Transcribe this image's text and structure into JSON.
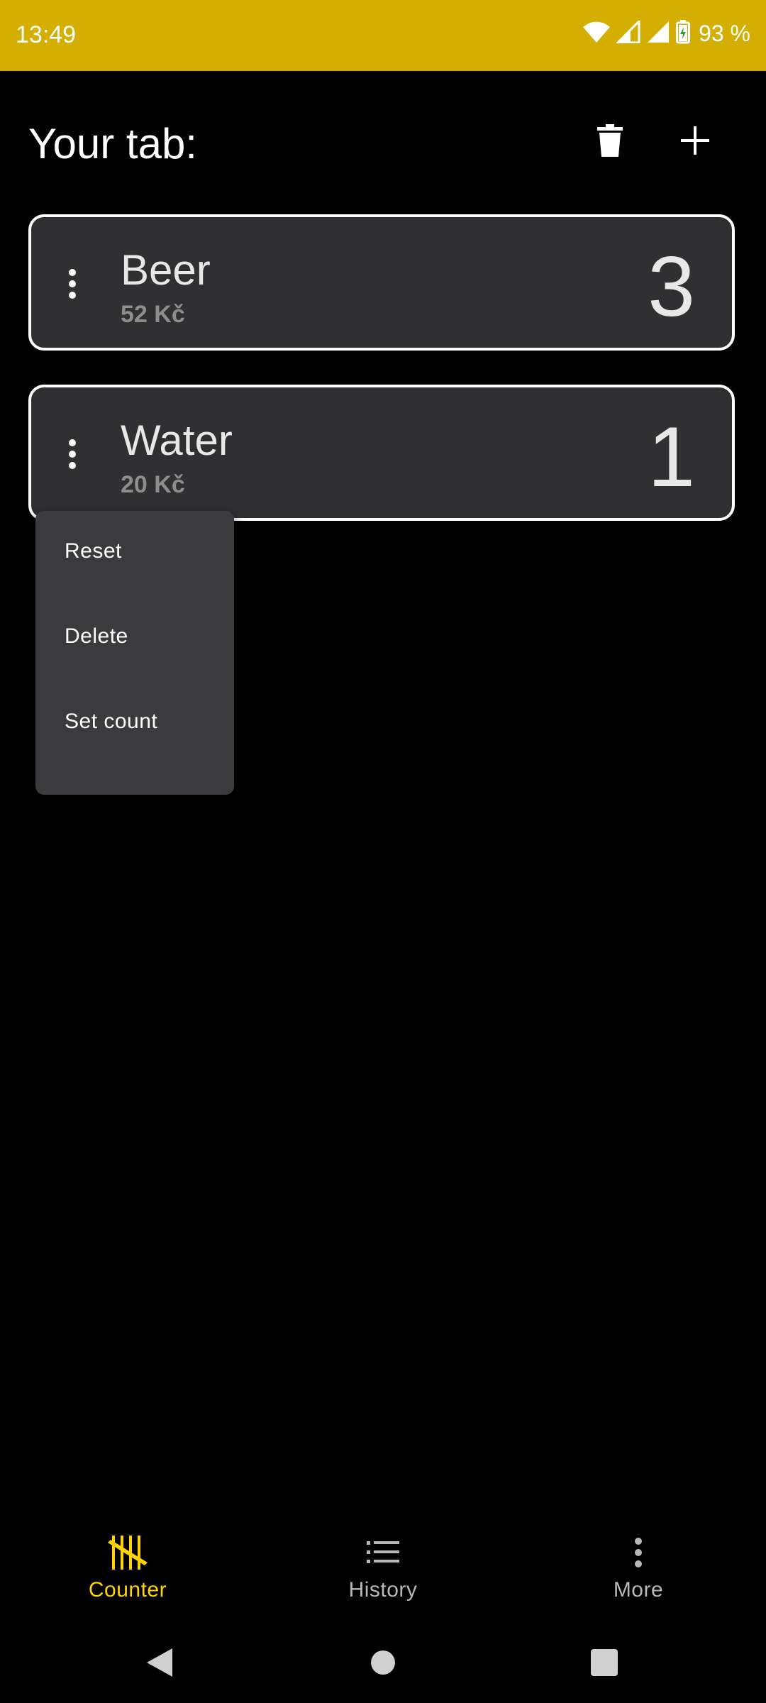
{
  "status_bar": {
    "time": "13:49",
    "battery": "93 %",
    "background_color": "#d4ae00",
    "icons": [
      "wifi-icon",
      "signal-icon",
      "signal-icon",
      "battery-charging-icon"
    ]
  },
  "header": {
    "title": "Your tab:",
    "actions": [
      "trash-icon",
      "plus-icon"
    ]
  },
  "items": [
    {
      "name": "Beer",
      "price": "52 Kč",
      "count": "3"
    },
    {
      "name": "Water",
      "price": "20 Kč",
      "count": "1"
    }
  ],
  "context_menu": {
    "items": [
      "Reset",
      "Delete",
      "Set count"
    ]
  },
  "bottom_nav": {
    "tabs": [
      {
        "label": "Counter",
        "icon": "tally-marks-icon",
        "active": true
      },
      {
        "label": "History",
        "icon": "list-icon",
        "active": false
      },
      {
        "label": "More",
        "icon": "more-vertical-icon",
        "active": false
      }
    ],
    "active_color": "#ffd400",
    "inactive_color": "#b8b8b8"
  },
  "system_nav": {
    "buttons": [
      "back-icon",
      "home-icon",
      "recents-icon"
    ]
  }
}
